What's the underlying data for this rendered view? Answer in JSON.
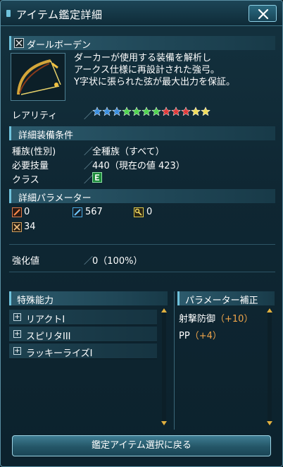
{
  "window": {
    "title": "アイテム鑑定詳細"
  },
  "item": {
    "name": "ダールボーデン",
    "description": [
      "ダーカーが使用する装備を解析し",
      "アークス仕様に再設計された強弓。",
      "Y字状に張られた弦が最大出力を保証。"
    ]
  },
  "rarity": {
    "label": "レアリティ",
    "separator": "／",
    "stars": [
      "#3a8fe0",
      "#3a8fe0",
      "#3a8fe0",
      "#4fd44f",
      "#4fd44f",
      "#4fd44f",
      "#4fd44f",
      "#e03a3a",
      "#e03a3a",
      "#e03a3a",
      "#f0dc5a",
      "#f0dc5a"
    ]
  },
  "requirements": {
    "header": "詳細装備条件",
    "rows": [
      {
        "label": "種族(性別)",
        "value": "全種族（すべて）"
      },
      {
        "label": "必要技量",
        "value": "440（現在の値 423）"
      },
      {
        "label": "クラス",
        "value": ""
      }
    ],
    "class_icon": "ranger-class-icon"
  },
  "parameters": {
    "header": "詳細パラメーター",
    "values": [
      {
        "icon": "melee-attack-icon",
        "value": "0"
      },
      {
        "icon": "ranged-attack-icon",
        "value": "567"
      },
      {
        "icon": "tech-attack-icon",
        "value": "0"
      },
      {
        "icon": "dexterity-icon",
        "value": "34"
      }
    ]
  },
  "enhancement": {
    "label": "強化値",
    "value": "0（100%）"
  },
  "special_abilities": {
    "header": "特殊能力",
    "items": [
      "リアクトI",
      "スピリタIII",
      "ラッキーライズI"
    ]
  },
  "param_correction": {
    "header": "パラメーター補正",
    "items": [
      {
        "label": "射撃防御",
        "bonus": "（+10）"
      },
      {
        "label": "PP",
        "bonus": "（+4）"
      }
    ]
  },
  "footer": {
    "back_label": "鑑定アイテム選択に戻る"
  },
  "colors": {
    "accent": "#6fc2dc",
    "bonus": "#f0a54a"
  }
}
